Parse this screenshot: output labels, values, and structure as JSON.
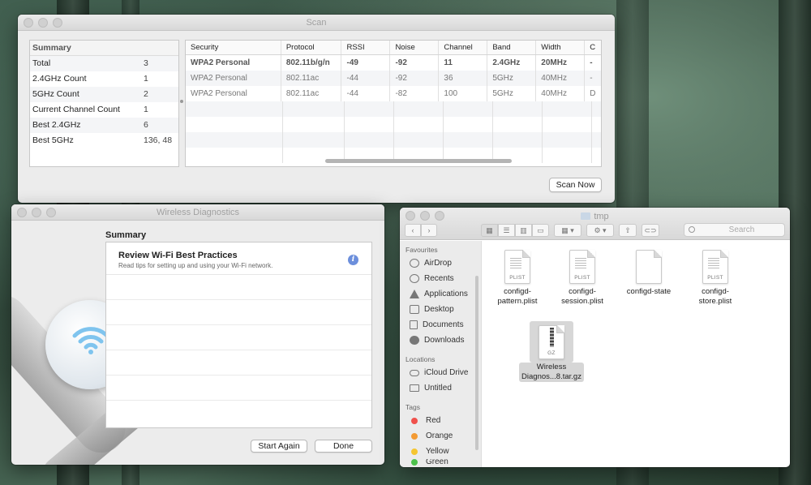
{
  "scan": {
    "title": "Scan",
    "summary_header": "Summary",
    "summary_rows": [
      {
        "label": "Total",
        "value": "3"
      },
      {
        "label": "2.4GHz Count",
        "value": "1"
      },
      {
        "label": "5GHz Count",
        "value": "2"
      },
      {
        "label": "Current Channel Count",
        "value": "1"
      },
      {
        "label": "Best 2.4GHz",
        "value": "6"
      },
      {
        "label": "Best 5GHz",
        "value": "136, 48"
      }
    ],
    "columns": [
      "Security",
      "Protocol",
      "RSSI",
      "Noise",
      "Channel",
      "Band",
      "Width",
      "C"
    ],
    "rows": [
      [
        "WPA2 Personal",
        "802.11b/g/n",
        "-49",
        "-92",
        "11",
        "2.4GHz",
        "20MHz",
        "-"
      ],
      [
        "WPA2 Personal",
        "802.11ac",
        "-44",
        "-92",
        "36",
        "5GHz",
        "40MHz",
        "-"
      ],
      [
        "WPA2 Personal",
        "802.11ac",
        "-44",
        "-82",
        "100",
        "5GHz",
        "40MHz",
        "D"
      ]
    ],
    "scan_now_label": "Scan Now"
  },
  "diagnostics": {
    "title": "Wireless Diagnostics",
    "heading": "Summary",
    "item_title": "Review Wi-Fi Best Practices",
    "item_subtitle": "Read tips for setting up and using your Wi-Fi network.",
    "info_glyph": "i",
    "start_again_label": "Start Again",
    "done_label": "Done"
  },
  "finder": {
    "title": "tmp",
    "search_placeholder": "Search",
    "sections": {
      "favourites": "Favourites",
      "locations": "Locations",
      "tags": "Tags"
    },
    "favourites": [
      {
        "label": "AirDrop",
        "icon": "airdrop-icon"
      },
      {
        "label": "Recents",
        "icon": "clock-icon"
      },
      {
        "label": "Applications",
        "icon": "applications-icon"
      },
      {
        "label": "Desktop",
        "icon": "desktop-icon"
      },
      {
        "label": "Documents",
        "icon": "document-icon"
      },
      {
        "label": "Downloads",
        "icon": "download-icon"
      }
    ],
    "locations": [
      {
        "label": "iCloud Drive",
        "icon": "cloud-icon"
      },
      {
        "label": "Untitled",
        "icon": "disk-icon"
      }
    ],
    "tags": [
      {
        "label": "Red",
        "color": "#f0514c"
      },
      {
        "label": "Orange",
        "color": "#f39a33"
      },
      {
        "label": "Yellow",
        "color": "#f5c530"
      },
      {
        "label": "Green",
        "color": "#4cc14b"
      }
    ],
    "files": [
      {
        "name_line1": "configd-",
        "name_line2": "pattern.plist",
        "tag": "PLIST"
      },
      {
        "name_line1": "configd-",
        "name_line2": "session.plist",
        "tag": "PLIST"
      },
      {
        "name_line1": "configd-state",
        "name_line2": "",
        "tag": ""
      },
      {
        "name_line1": "configd-",
        "name_line2": "store.plist",
        "tag": "PLIST"
      },
      {
        "name_line1": "Wireless",
        "name_line2": "Diagnos...8.tar.gz",
        "tag": "GZ"
      }
    ]
  }
}
